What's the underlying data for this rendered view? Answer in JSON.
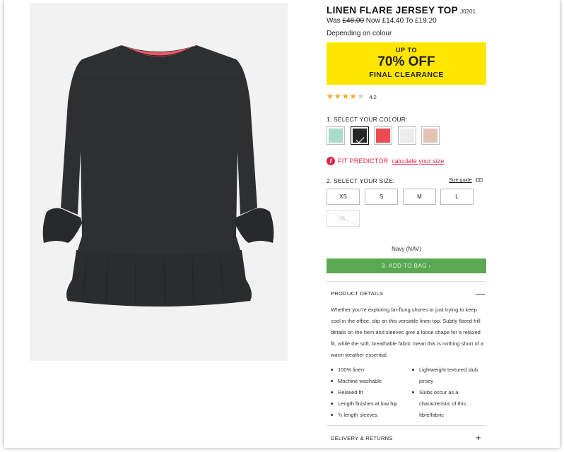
{
  "product": {
    "title": "LINEN FLARE JERSEY TOP",
    "code": "J0201",
    "price": {
      "was_label": "Was",
      "was_price": "£48.00",
      "now_text": "Now £14.40 To £19.20"
    },
    "price_note": "Depending on colour",
    "promo": {
      "line1": "UP TO",
      "line2": "70% OFF",
      "line3": "FINAL CLEARANCE",
      "background": "#ffe600"
    },
    "rating": {
      "value": "4.2",
      "stars_filled": 4,
      "stars_total": 5
    }
  },
  "colour": {
    "label": "1. SELECT YOUR COLOUR:",
    "swatches": [
      {
        "name": "mint",
        "color": "#a9dccc",
        "selected": false
      },
      {
        "name": "navy",
        "color": "#262729",
        "selected": true
      },
      {
        "name": "coral",
        "color": "#ec4a55",
        "selected": false
      },
      {
        "name": "white",
        "color": "#ececec",
        "selected": false
      },
      {
        "name": "blush",
        "color": "#e4c3b5",
        "selected": false
      }
    ],
    "selected_name": "Navy (NAV)"
  },
  "fit_predictor": {
    "icon": "f",
    "label": "FIT PREDICTOR",
    "link": "calculate your size"
  },
  "size": {
    "label": "2. SELECT YOUR SIZE:",
    "guide_link": "Size guide",
    "options": [
      {
        "label": "XS",
        "available": true
      },
      {
        "label": "S",
        "available": true
      },
      {
        "label": "M",
        "available": true
      },
      {
        "label": "L",
        "available": true
      },
      {
        "label": "XL",
        "available": false
      }
    ]
  },
  "cart": {
    "add_label": "3. ADD TO BAG ›",
    "color": "#5aa852"
  },
  "details": {
    "heading": "PRODUCT DETAILS",
    "toggle": "—",
    "description": "Whether you're exploring far-flung shores or just trying to keep cool in the office, slip on this versatile linen top. Subtly flared frill details on the hem and sleeves give a loose shape for a relaxed fit, while the soft, breathable fabric mean this is nothing short of a warm weather essential.",
    "bullets_left": [
      "100% linen",
      "Machine washable",
      "Relaxed fit",
      "Length finishes at low hip",
      "¾ length sleeves"
    ],
    "bullets_right": [
      "Lightweight textured slub jersey",
      "Slubs occur as a characteristic of this fibre/fabric"
    ]
  },
  "delivery": {
    "heading": "DELIVERY & RETURNS",
    "toggle": "+"
  },
  "icons": {
    "accent": "#e0244b"
  }
}
